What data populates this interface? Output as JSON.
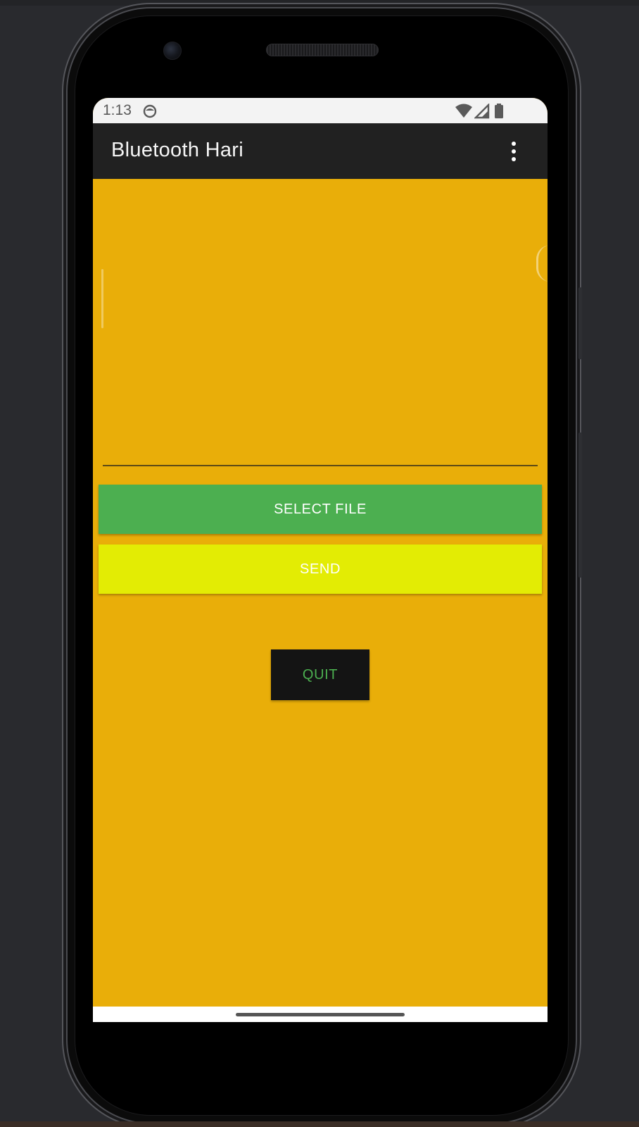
{
  "status_bar": {
    "time": "1:13",
    "icons": [
      "sync-icon",
      "wifi-icon",
      "cell-signal-icon",
      "battery-icon"
    ]
  },
  "app_bar": {
    "title": "Bluetooth Hari",
    "menu_icon": "more-vert-icon"
  },
  "main": {
    "text_area_value": "",
    "buttons": {
      "select_file": "SELECT FILE",
      "send": "SEND",
      "quit": "QUIT"
    }
  },
  "colors": {
    "background": "#e9ae09",
    "app_bar": "#212121",
    "select_file_button": "#4caf50",
    "send_button": "#e3ec04",
    "quit_button": "#141414",
    "quit_text": "#4caf50"
  }
}
